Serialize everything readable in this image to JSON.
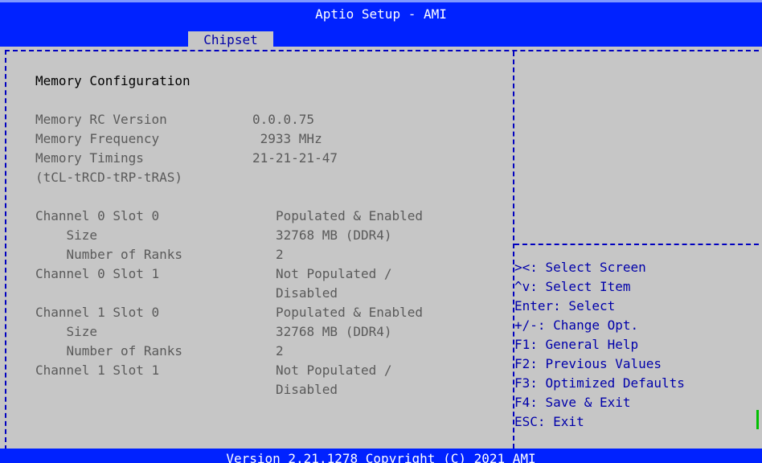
{
  "window": {
    "title": "Aptio Setup - AMI"
  },
  "tabs": [
    {
      "label": "Chipset"
    }
  ],
  "section": {
    "heading": "Memory Configuration"
  },
  "rows": [
    {
      "label": "Memory RC Version",
      "value": "0.0.0.75"
    },
    {
      "label": "Memory Frequency",
      "value": " 2933 MHz"
    },
    {
      "label": "Memory Timings",
      "value": "21-21-21-47"
    },
    {
      "label": "(tCL-tRCD-tRP-tRAS)",
      "value": ""
    },
    {
      "label": "Channel 0 Slot 0",
      "value": "Populated & Enabled"
    },
    {
      "label": "    Size",
      "value": "32768 MB (DDR4)"
    },
    {
      "label": "    Number of Ranks",
      "value": "2"
    },
    {
      "label": "Channel 0 Slot 1",
      "value": "Not Populated /"
    },
    {
      "label": "",
      "value": "Disabled"
    },
    {
      "label": "Channel 1 Slot 0",
      "value": "Populated & Enabled"
    },
    {
      "label": "    Size",
      "value": "32768 MB (DDR4)"
    },
    {
      "label": "    Number of Ranks",
      "value": "2"
    },
    {
      "label": "Channel 1 Slot 1",
      "value": "Not Populated /"
    },
    {
      "label": "",
      "value": "Disabled"
    }
  ],
  "help": [
    "><: Select Screen",
    "^v: Select Item",
    "Enter: Select",
    "+/-: Change Opt.",
    "F1: General Help",
    "F2: Previous Values",
    "F3: Optimized Defaults",
    "F4: Save & Exit",
    "ESC: Exit"
  ],
  "footer": {
    "text": "Version 2.21.1278 Copyright (C) 2021 AMI"
  },
  "colors": {
    "bar": "#0022ff",
    "background": "#c6c6c6",
    "help_text": "#0000aa",
    "dim_text": "#5a5a5a"
  }
}
